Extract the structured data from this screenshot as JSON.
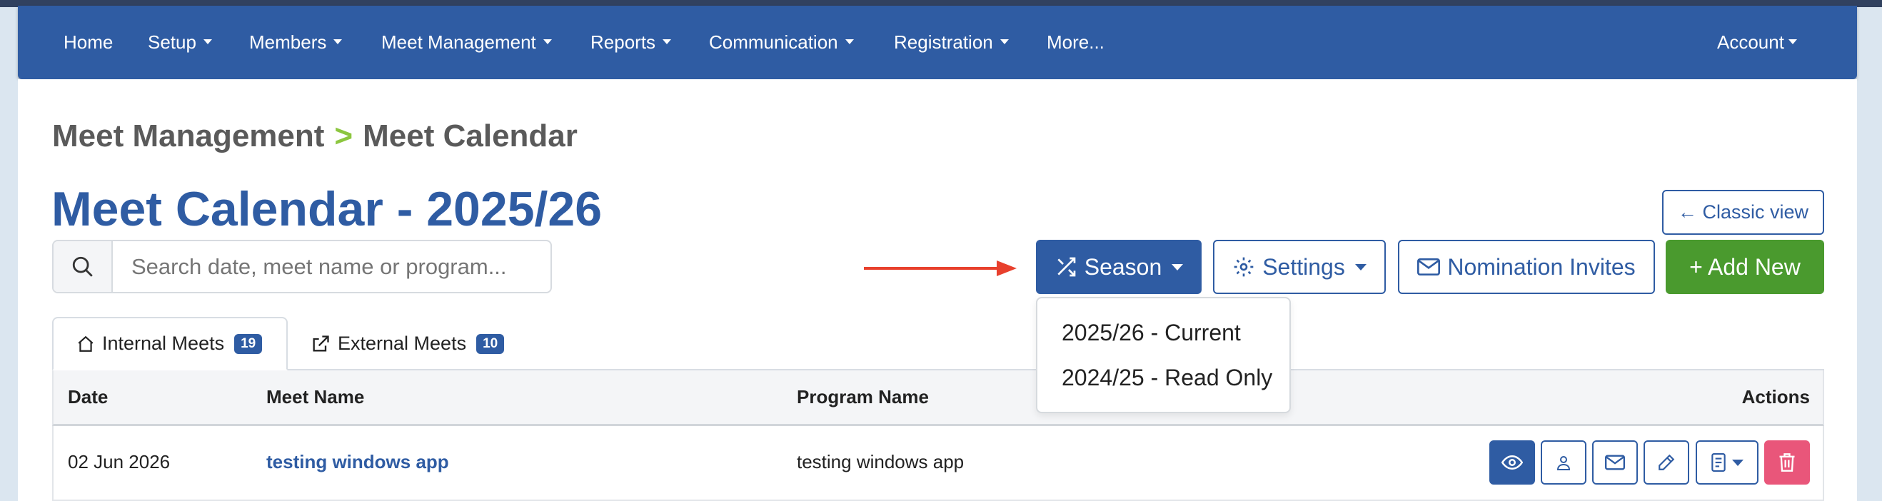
{
  "nav": {
    "items": [
      {
        "label": "Home",
        "dropdown": false
      },
      {
        "label": "Setup",
        "dropdown": true
      },
      {
        "label": "Members",
        "dropdown": true
      },
      {
        "label": "Meet Management",
        "dropdown": true
      },
      {
        "label": "Reports",
        "dropdown": true
      },
      {
        "label": "Communication",
        "dropdown": true
      },
      {
        "label": "Registration",
        "dropdown": true
      },
      {
        "label": "More...",
        "dropdown": false
      }
    ],
    "account": "Account"
  },
  "breadcrumb": {
    "parent": "Meet Management",
    "separator": ">",
    "current": "Meet Calendar"
  },
  "page_title": "Meet Calendar - 2025/26",
  "search": {
    "placeholder": "Search date, meet name or program...",
    "value": ""
  },
  "toolbar": {
    "classic_view": "← Classic view",
    "season": "Season",
    "settings": "Settings",
    "nomination_invites": "Nomination Invites",
    "add_new": "+ Add New"
  },
  "season_menu": {
    "options": [
      "2025/26 - Current",
      "2024/25 - Read Only"
    ]
  },
  "tabs": [
    {
      "label": "Internal Meets",
      "count": "19",
      "active": true,
      "icon": "home-icon"
    },
    {
      "label": "External Meets",
      "count": "10",
      "active": false,
      "icon": "external-link-icon"
    }
  ],
  "table": {
    "columns": [
      "Date",
      "Meet Name",
      "Program Name",
      "Actions"
    ],
    "rows": [
      {
        "date": "02 Jun 2026",
        "meet_name": "testing windows app",
        "program_name": "testing windows app"
      }
    ]
  },
  "colors": {
    "brand": "#2f5ca3",
    "accent_green": "#4a9a2e",
    "danger": "#e9567a",
    "breadcrumb_separator": "#8cc63f",
    "annotation_arrow": "#e8402d"
  }
}
